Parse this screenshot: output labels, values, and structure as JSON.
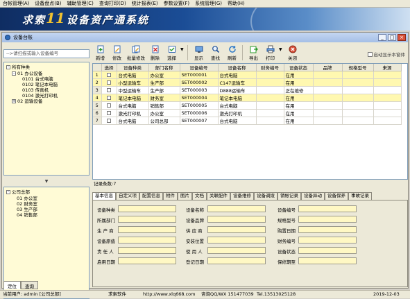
{
  "menu": [
    "台帐管理(A)",
    "设备盘点(B)",
    "辅助管理(C)",
    "查询打印(D)",
    "统计报表(E)",
    "参数设置(F)",
    "系统管理(G)",
    "帮助(H)"
  ],
  "banner": {
    "prefix": "求索",
    "version": "11",
    "suffix": "设备资产通系统"
  },
  "window": {
    "title": "设备台账",
    "min": "_",
    "max": "□",
    "close": "×"
  },
  "search": {
    "placeholder": "-->请扫描或输入设备编号"
  },
  "tree_category": {
    "root": "所有种类",
    "n01": "01 办公设备",
    "n0101": "0101 台式电脑",
    "n0102": "0102 笔记本电脑",
    "n0103": "0103 传真机",
    "n0104": "0104 激光打印机",
    "n02": "02 运输设备"
  },
  "splitter_arrow": "▼",
  "tree_dept": {
    "root": "公司总部",
    "d01": "01 办公室",
    "d02": "02 财务室",
    "d03": "03 生产部",
    "d04": "04 销售部"
  },
  "left_tabs": [
    "定位",
    "查询"
  ],
  "toolbar": {
    "add": "新增",
    "edit": "修改",
    "batch_edit": "批量修改",
    "delete": "删除",
    "select": "选择",
    "show": "显示",
    "find": "查找",
    "refresh": "刷新",
    "export": "导出",
    "print": "打印",
    "close": "关闭",
    "dropdown": "▼",
    "auto_show": "启动显示本窗体"
  },
  "grid": {
    "columns": [
      "选择",
      "设备种类",
      "部门名称",
      "设备编号",
      "设备名称",
      "财务编号",
      "设备状态",
      "品牌",
      "规格型号",
      "来源"
    ],
    "rows": [
      {
        "n": "1",
        "type": "台式电脑",
        "dept": "办公室",
        "code": "SET000001",
        "name": "台式电脑",
        "fin": "",
        "status": "在用"
      },
      {
        "n": "2",
        "type": "小型运输车",
        "dept": "生产部",
        "code": "SET000002",
        "name": "C147运输车",
        "fin": "",
        "status": "在用"
      },
      {
        "n": "3",
        "type": "中型运输车",
        "dept": "生产部",
        "code": "SET000003",
        "name": "D888运输车",
        "fin": "",
        "status": "正在维修"
      },
      {
        "n": "4",
        "type": "笔记本电脑",
        "dept": "财务室",
        "code": "SET000004",
        "name": "笔记本电脑",
        "fin": "",
        "status": "在用"
      },
      {
        "n": "5",
        "type": "台式电脑",
        "dept": "销售部",
        "code": "SET000005",
        "name": "台式电脑",
        "fin": "",
        "status": "在用"
      },
      {
        "n": "6",
        "type": "激光打印机",
        "dept": "办公室",
        "code": "SET000006",
        "name": "激光打印机",
        "fin": "",
        "status": "在用"
      },
      {
        "n": "7",
        "type": "台式电脑",
        "dept": "公司总部",
        "code": "SET000007",
        "name": "台式电脑",
        "fin": "",
        "status": "在用"
      }
    ]
  },
  "record_count": "记录条数:7",
  "detail_tabs": [
    "基本信息",
    "自定义项",
    "配置信息",
    "附件",
    "图片",
    "文档",
    "关联配件",
    "设备维修",
    "设备调拨",
    "销帐记录",
    "设备异动",
    "设备保养",
    "事故记录"
  ],
  "form": {
    "col1": [
      "设备种类",
      "所属部门",
      "生 产 商",
      "设备原值",
      "责 任 人",
      "启用日期"
    ],
    "col2": [
      "设备名称",
      "设备品牌",
      "供 应 商",
      "安装位置",
      "使 用 人",
      "登记日期"
    ],
    "col3": [
      "设备编号",
      "规格型号",
      "购置日期",
      "财务编号",
      "设备状态",
      "保修期至"
    ]
  },
  "status": {
    "user": "当前用户: admin [公司总部]",
    "company": "求索软件",
    "url": "http://www.xlq668.com",
    "qq": "咨询QQ/WX 151477039",
    "tel": "Tel.13513025128",
    "date": "2019-12-03"
  }
}
